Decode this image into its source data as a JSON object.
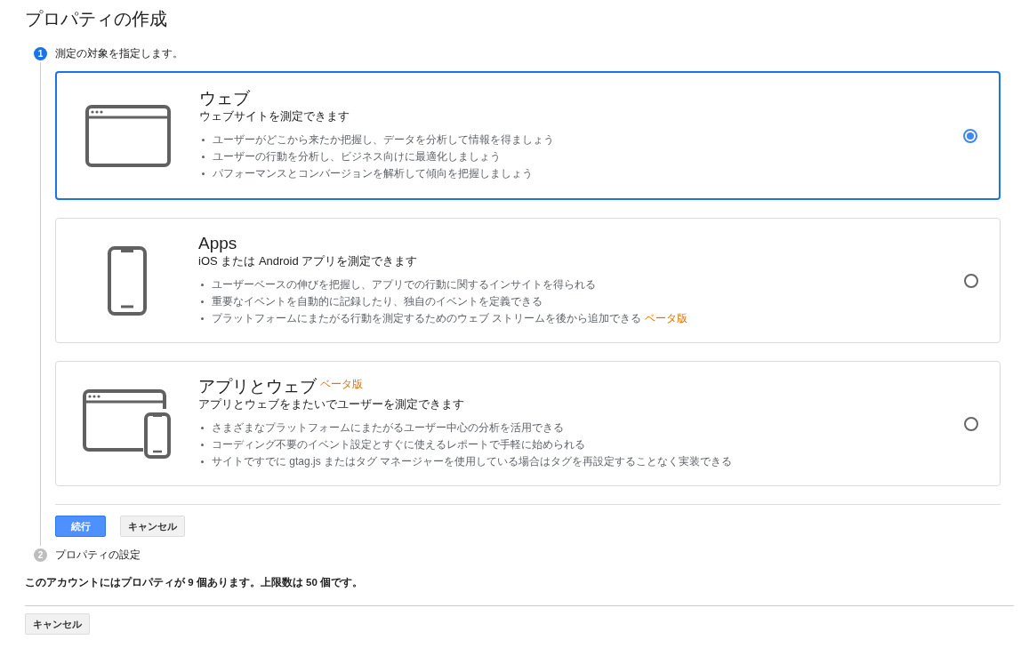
{
  "page_title": "プロパティの作成",
  "steps": [
    {
      "number": "1",
      "label": "測定の対象を指定します。",
      "active": true
    },
    {
      "number": "2",
      "label": "プロパティの設定",
      "active": false
    }
  ],
  "options": [
    {
      "kind": "web",
      "title": "ウェブ",
      "subtitle": "ウェブサイトを測定できます",
      "selected": true,
      "bullets": [
        {
          "text": "ユーザーがどこから来たか把握し、データを分析して情報を得ましょう"
        },
        {
          "text": "ユーザーの行動を分析し、ビジネス向けに最適化しましょう"
        },
        {
          "text": "パフォーマンスとコンバージョンを解析して傾向を把握しましょう"
        }
      ]
    },
    {
      "kind": "app",
      "title": "Apps",
      "subtitle": "iOS または Android アプリを測定できます",
      "selected": false,
      "bullets": [
        {
          "text": "ユーザーベースの伸びを把握し、アプリでの行動に関するインサイトを得られる"
        },
        {
          "text": "重要なイベントを自動的に記録したり、独自のイベントを定義できる"
        },
        {
          "text": "プラットフォームにまたがる行動を測定するためのウェブ ストリームを後から追加できる",
          "badge": "ベータ版"
        }
      ]
    },
    {
      "kind": "app_web",
      "title": "アプリとウェブ",
      "title_badge": "ベータ版",
      "subtitle": "アプリとウェブをまたいでユーザーを測定できます",
      "selected": false,
      "bullets": [
        {
          "text": "さまざまなプラットフォームにまたがるユーザー中心の分析を活用できる"
        },
        {
          "text": "コーディング不要のイベント設定とすぐに使えるレポートで手軽に始められる"
        },
        {
          "text": "サイトですでに gtag.js またはタグ マネージャーを使用している場合はタグを再設定することなく実装できる"
        }
      ]
    }
  ],
  "step_buttons": {
    "continue": "続行",
    "cancel": "キャンセル"
  },
  "info_text": "このアカウントにはプロパティが 9 個あります。上限数は 50 個です。",
  "footer_cancel": "キャンセル"
}
